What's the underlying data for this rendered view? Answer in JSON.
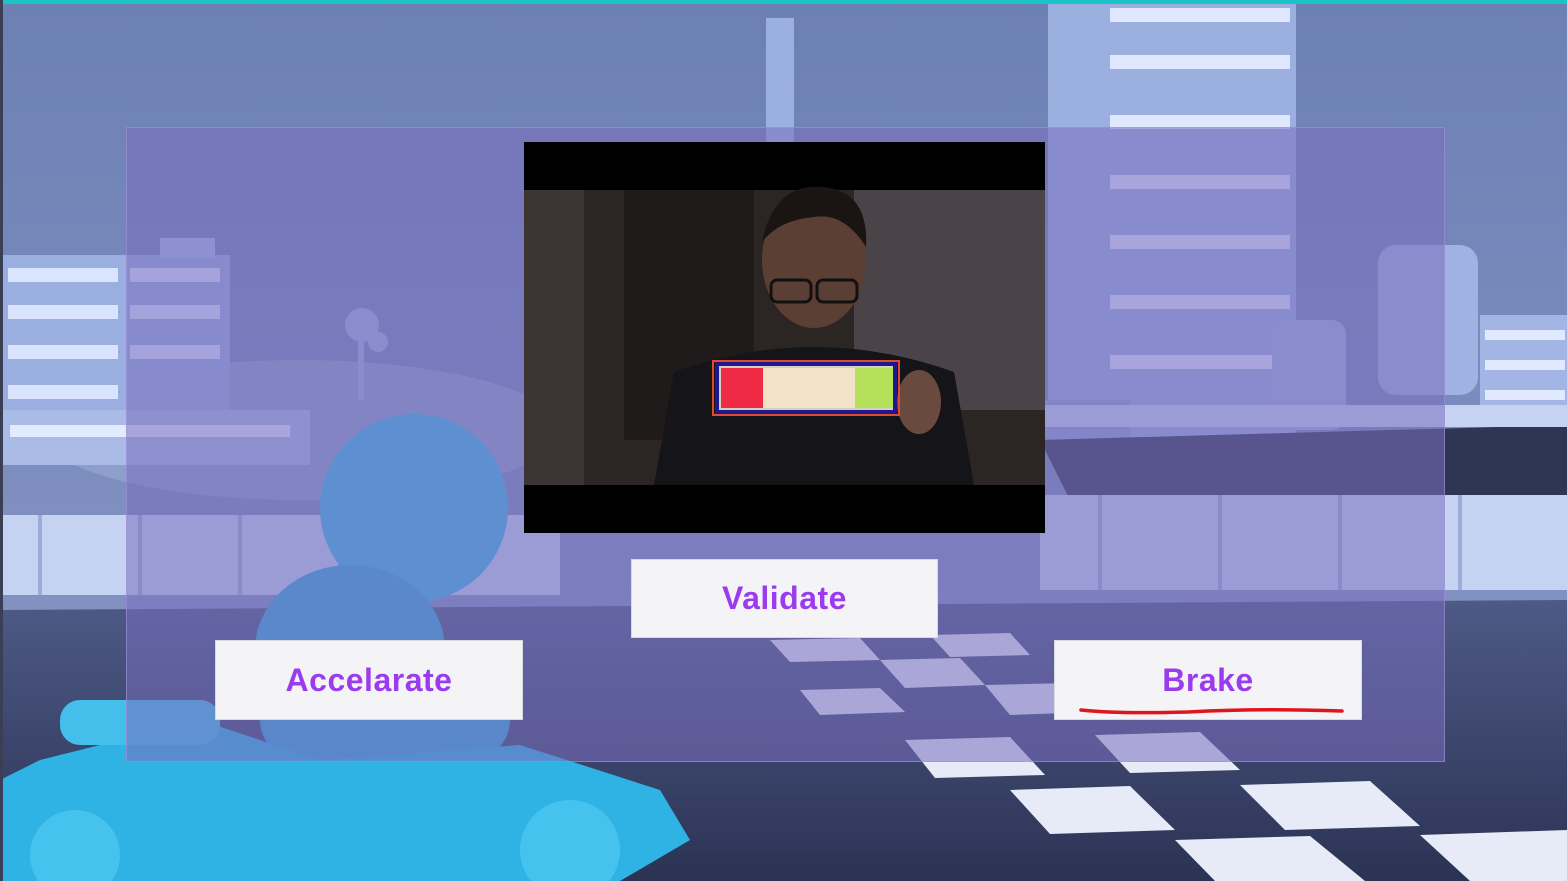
{
  "buttons": {
    "validate": "Validate",
    "accelerate": "Accelarate",
    "brake": "Brake"
  },
  "colors": {
    "button_text": "#9b3bf0",
    "button_bg": "#f4f4f6",
    "panel": "#786ebe",
    "annotation_underline": "#e0141e",
    "detection_box": "#1c1890"
  },
  "camera": {
    "detected_card_colors": [
      "#ee2a45",
      "#f2e3c8",
      "#b5e05a"
    ]
  }
}
